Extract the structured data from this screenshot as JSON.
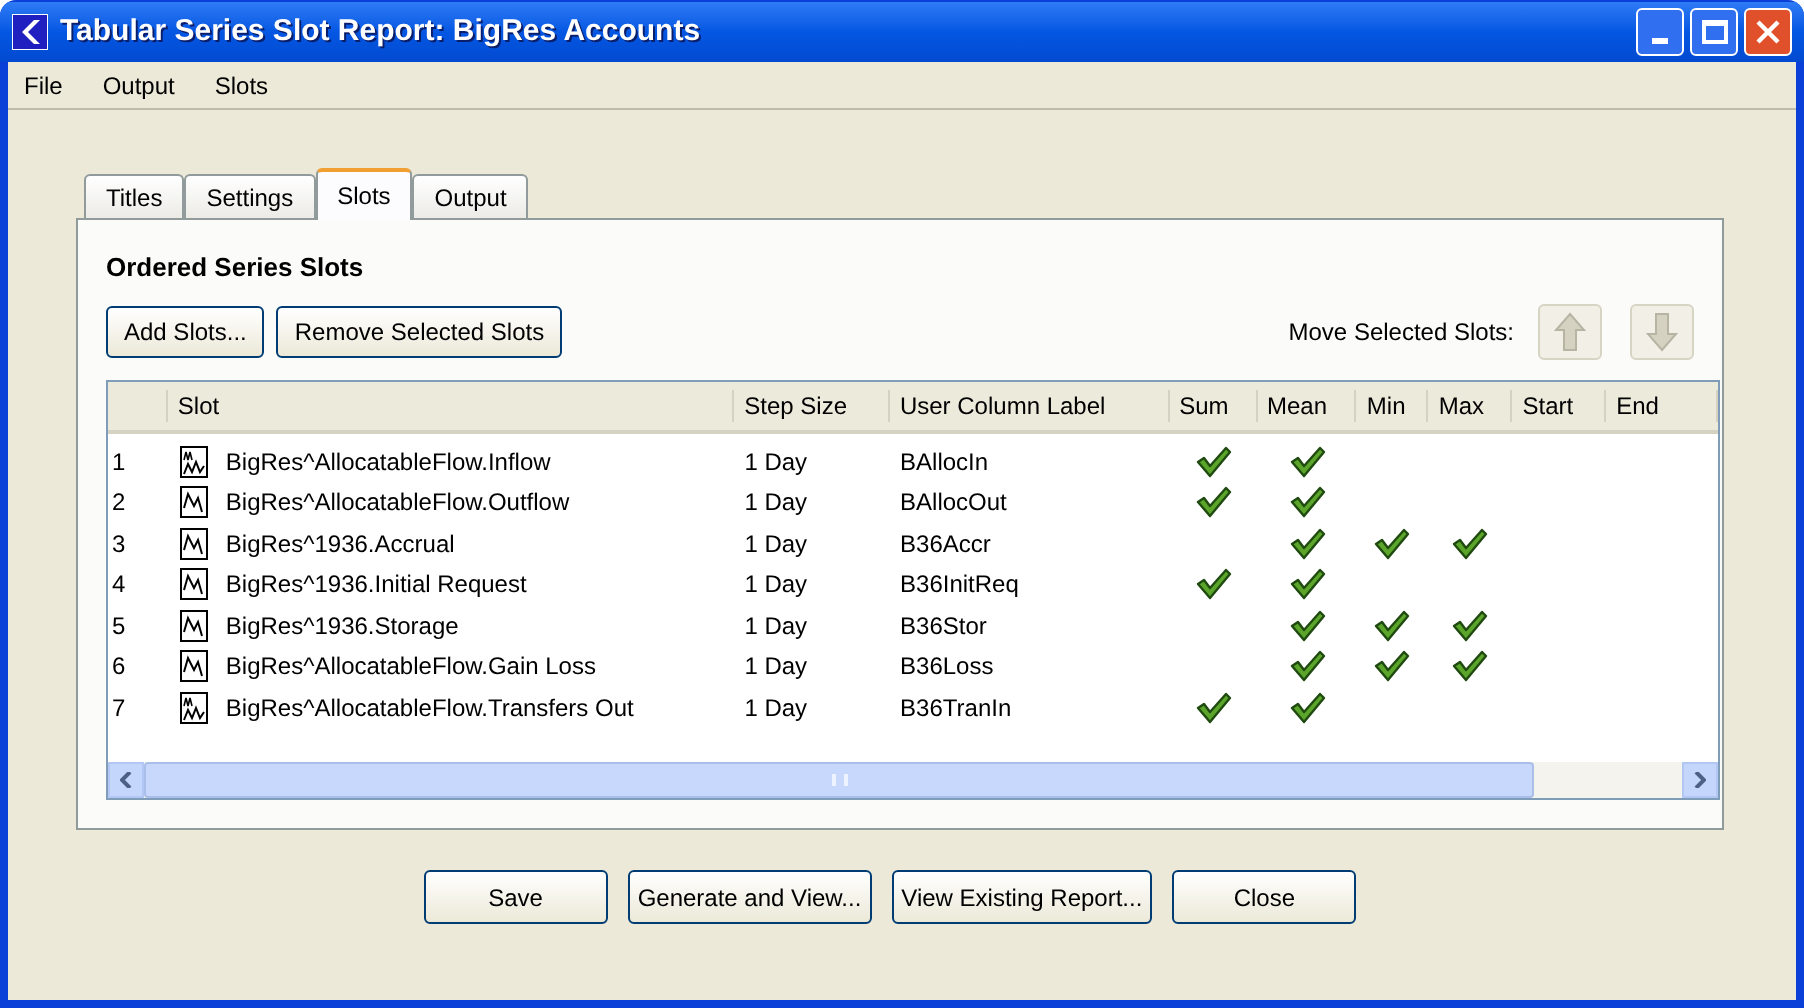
{
  "window": {
    "title": "Tabular Series Slot Report: BigRes Accounts"
  },
  "menu": [
    "File",
    "Output",
    "Slots"
  ],
  "tabs": [
    {
      "label": "Titles",
      "selected": false
    },
    {
      "label": "Settings",
      "selected": false
    },
    {
      "label": "Slots",
      "selected": true
    },
    {
      "label": "Output",
      "selected": false
    }
  ],
  "section_title": "Ordered Series Slots",
  "toolbar": {
    "add_button": "Add Slots...",
    "remove_button": "Remove Selected Slots",
    "move_label": "Move Selected Slots:",
    "move_up_disabled": true,
    "move_down_disabled": true
  },
  "table": {
    "columns": [
      "Slot",
      "Step Size",
      "User Column Label",
      "Sum",
      "Mean",
      "Min",
      "Max",
      "Start",
      "End"
    ],
    "rows": [
      {
        "number": "1",
        "kind": "multi",
        "slot": "BigRes^AllocatableFlow.Inflow",
        "step": "1 Day",
        "label": "BAllocIn",
        "checks": [
          true,
          true,
          false,
          false,
          false,
          false
        ]
      },
      {
        "number": "2",
        "kind": "single",
        "slot": "BigRes^AllocatableFlow.Outflow",
        "step": "1 Day",
        "label": "BAllocOut",
        "checks": [
          true,
          true,
          false,
          false,
          false,
          false
        ]
      },
      {
        "number": "3",
        "kind": "single",
        "slot": "BigRes^1936.Accrual",
        "step": "1 Day",
        "label": "B36Accr",
        "checks": [
          false,
          true,
          true,
          true,
          false,
          false
        ]
      },
      {
        "number": "4",
        "kind": "single",
        "slot": "BigRes^1936.Initial Request",
        "step": "1 Day",
        "label": "B36InitReq",
        "checks": [
          true,
          true,
          false,
          false,
          false,
          false
        ]
      },
      {
        "number": "5",
        "kind": "single",
        "slot": "BigRes^1936.Storage",
        "step": "1 Day",
        "label": "B36Stor",
        "checks": [
          false,
          true,
          true,
          true,
          false,
          false
        ]
      },
      {
        "number": "6",
        "kind": "single",
        "slot": "BigRes^AllocatableFlow.Gain Loss",
        "step": "1 Day",
        "label": "B36Loss",
        "checks": [
          false,
          true,
          true,
          true,
          false,
          false
        ]
      },
      {
        "number": "7",
        "kind": "multi",
        "slot": "BigRes^AllocatableFlow.Transfers Out",
        "step": "1 Day",
        "label": "B36TranIn",
        "checks": [
          true,
          true,
          false,
          false,
          false,
          false
        ]
      }
    ]
  },
  "buttons": [
    "Save",
    "Generate and View...",
    "View Existing Report...",
    "Close"
  ]
}
